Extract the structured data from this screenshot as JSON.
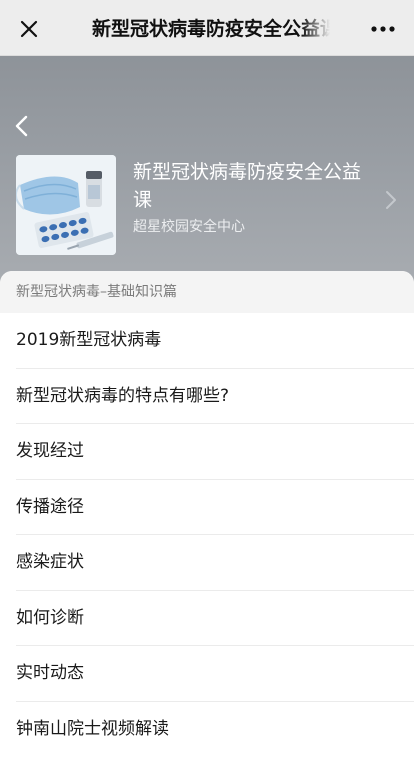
{
  "nav": {
    "title": "新型冠状病毒防疫安全公益课",
    "close_icon": "close-icon",
    "more_icon": "more-dots-icon"
  },
  "course": {
    "title": "新型冠状病毒防疫安全公益课",
    "subtitle": "超星校园安全中心",
    "thumbnail": "medical-mask-and-pills-image"
  },
  "section": {
    "header": "新型冠状病毒–基础知识篇",
    "items": [
      {
        "label": "2019新型冠状病毒"
      },
      {
        "label": "新型冠状病毒的特点有哪些?"
      },
      {
        "label": "发现经过"
      },
      {
        "label": "传播途径"
      },
      {
        "label": "感染症状"
      },
      {
        "label": "如何诊断"
      },
      {
        "label": "实时动态"
      },
      {
        "label": "钟南山院士视频解读"
      }
    ]
  },
  "colors": {
    "header_band": "#999ea4",
    "nav_bg": "#ededed",
    "section_header_bg": "#f4f4f4"
  }
}
